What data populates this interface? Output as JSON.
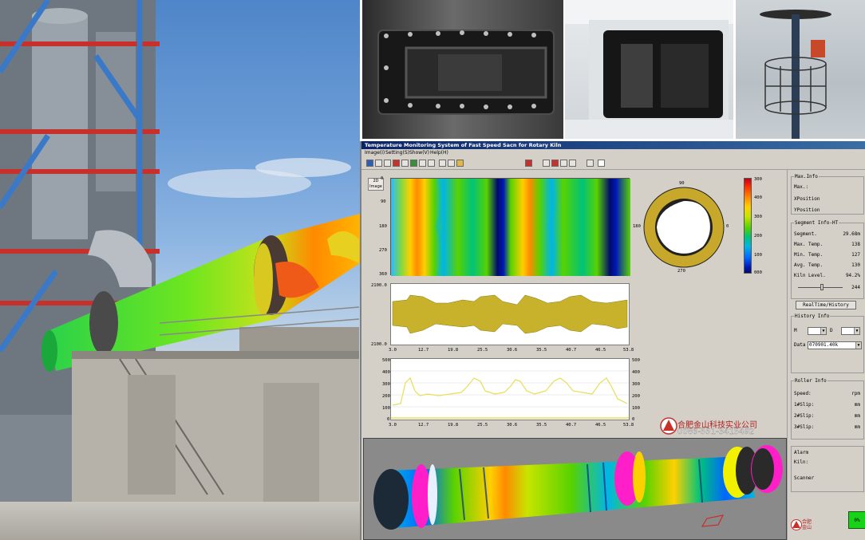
{
  "app": {
    "title": "Temperature Monitoring System of Fast Speed Sacn for Rotary Kiln",
    "menu": [
      "Image(I)",
      "Setting(S)",
      "Show(V)",
      "Help(H)"
    ]
  },
  "colors": {
    "title_bar": "#0a246a",
    "window_bg": "#d4d0c8",
    "heat_hot": "#ff2a00",
    "heat_warm": "#ffd000",
    "heat_mid": "#58d200",
    "heat_cool": "#00b6e6",
    "heat_cold": "#0018b8",
    "ring_gold": "#c8a82a",
    "profile_yellow": "#e8e060",
    "status_ok": "#18d21a"
  },
  "image_button": {
    "label": "2D Image"
  },
  "heat_map": {
    "y_ticks": [
      "0",
      "90",
      "180",
      "270",
      "360"
    ]
  },
  "colorbar": {
    "ticks": [
      "300",
      "400",
      "300",
      "200",
      "100",
      "000"
    ]
  },
  "polar_view": {
    "top": "90",
    "left": "180",
    "right": "0",
    "bottom": "270"
  },
  "profile_chart": {
    "y_top": "2100.0",
    "y_bottom": "2100.0",
    "x_ticks": [
      "3.0",
      "12.7",
      "19.8",
      "25.5",
      "30.6",
      "35.5",
      "40.7",
      "46.5",
      "53.8"
    ]
  },
  "temp_chart": {
    "y_left": [
      "500",
      "400",
      "300",
      "200",
      "100",
      "0"
    ],
    "y_right": [
      "500",
      "400",
      "300",
      "200",
      "100",
      "0"
    ],
    "x_ticks": [
      "3.0",
      "12.7",
      "19.8",
      "25.5",
      "30.6",
      "35.5",
      "40.7",
      "46.5",
      "53.8"
    ]
  },
  "company": {
    "name": "合肥金山科技实业公司",
    "phone": "0086-551-3415492",
    "logo_text": "合肥\n金山"
  },
  "max_info": {
    "title": "Max.Info",
    "max_label": "Max.:",
    "xpos_label": "XPosition",
    "ypos_label": "YPosition"
  },
  "segment_info": {
    "title": "Segment Info-HT",
    "segment_label": "Segment.",
    "segment_value": "29.68m",
    "max_temp_label": "Max. Temp.",
    "max_temp_value": "138",
    "min_temp_label": "Min. Temp.",
    "min_temp_value": "127",
    "avg_temp_label": "Avg. Temp.",
    "avg_temp_value": "130",
    "kiln_level_label": "Kiln Level.",
    "kiln_level_value": "94.2%",
    "slider_value": "244"
  },
  "realtime_button": {
    "label": "RealTime/History"
  },
  "history_info": {
    "title": "History Info",
    "m_label": "M",
    "d_label": "D",
    "data_label": "Data",
    "data_value": "070901.40k"
  },
  "roller_info": {
    "title": "Roller Info",
    "speed_label": "Speed:",
    "speed_unit": "rpm",
    "s1_label": "1#Slip:",
    "s2_label": "2#Slip:",
    "s3_label": "3#Slip:",
    "slip_unit": "mm"
  },
  "alarm": {
    "title": "Alarm",
    "kiln_label": "Kiln:",
    "scanner_label": "Scanner"
  },
  "status": {
    "value": "0%"
  }
}
